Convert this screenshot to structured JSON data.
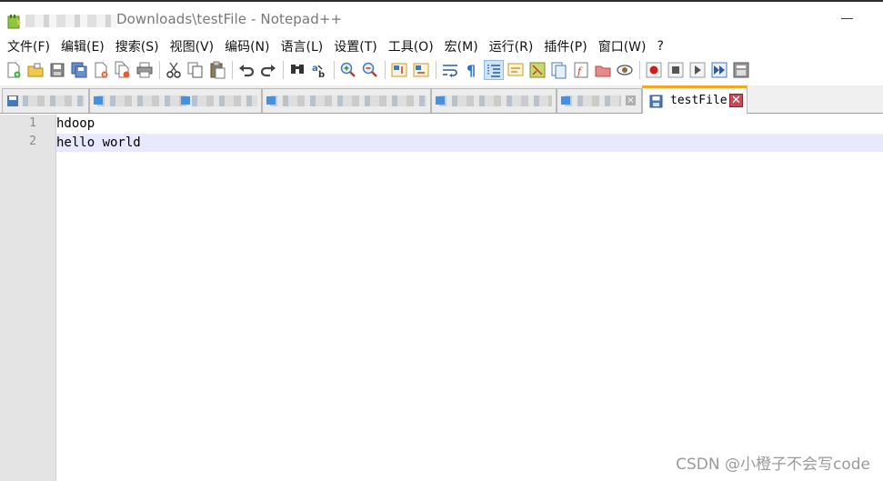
{
  "window": {
    "title": "Downloads\\testFile - Notepad++"
  },
  "menu": {
    "items": [
      "文件(F)",
      "编辑(E)",
      "搜索(S)",
      "视图(V)",
      "编码(N)",
      "语言(L)",
      "设置(T)",
      "工具(O)",
      "宏(M)",
      "运行(R)",
      "插件(P)",
      "窗口(W)",
      "?"
    ]
  },
  "toolbar": {
    "icons": [
      "new-file-icon",
      "open-file-icon",
      "save-icon",
      "save-all-icon",
      "close-icon",
      "close-all-icon",
      "print-icon",
      "cut-icon",
      "copy-icon",
      "paste-icon",
      "undo-icon",
      "redo-icon",
      "find-icon",
      "replace-icon",
      "zoom-in-icon",
      "zoom-out-icon",
      "sync-vertical-icon",
      "sync-horizontal-icon",
      "word-wrap-icon",
      "show-all-chars-icon",
      "indent-guide-icon",
      "language-udl-icon",
      "document-map-icon",
      "document-list-icon",
      "function-list-icon",
      "folder-workspace-icon",
      "monitoring-icon",
      "record-macro-icon",
      "stop-record-icon",
      "play-macro-icon",
      "run-macro-multiple-icon",
      "save-macro-icon"
    ]
  },
  "tabs": {
    "active": {
      "label": "testFile",
      "close": "✕"
    }
  },
  "editor": {
    "lines": [
      {
        "number": "1",
        "text": "hdoop"
      },
      {
        "number": "2",
        "text": "hello world"
      }
    ]
  },
  "watermark": "CSDN @小橙子不会写code"
}
